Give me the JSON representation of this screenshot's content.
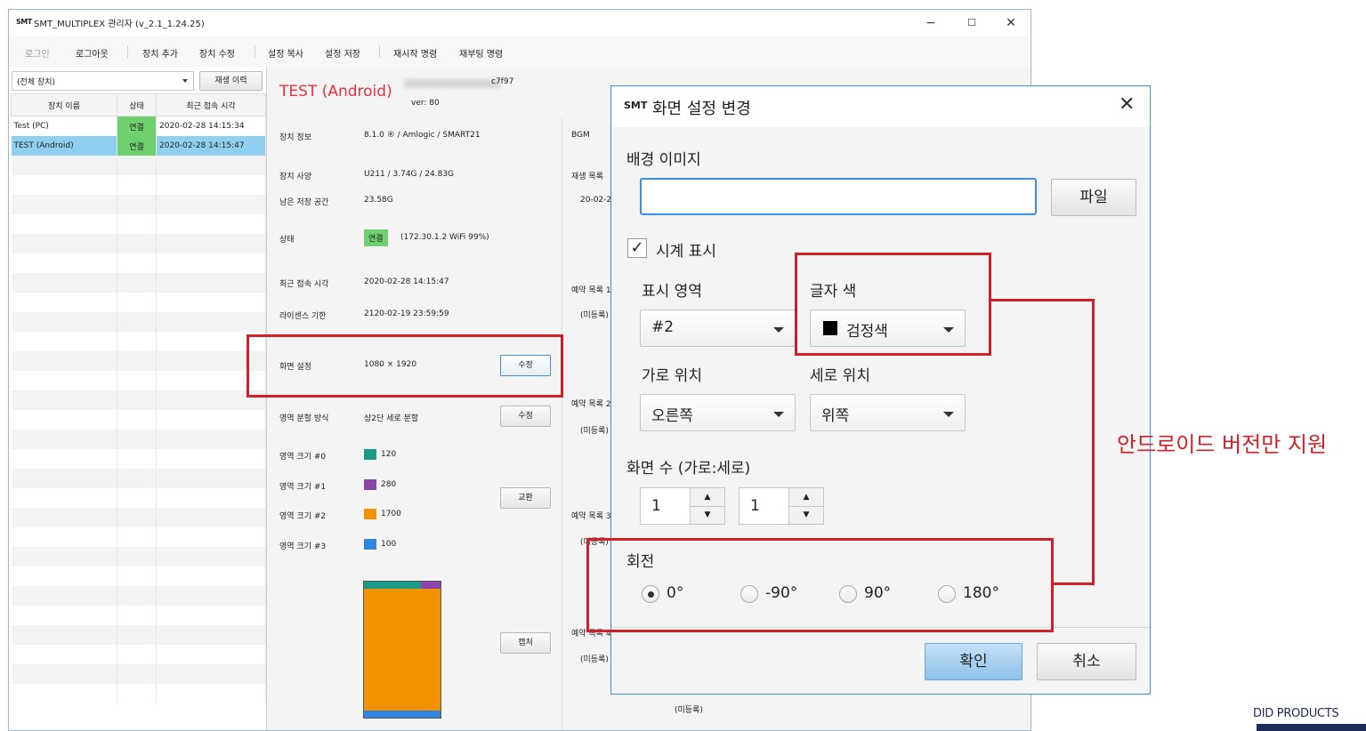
{
  "window": {
    "logo": "SMT",
    "title": "SMT_MULTIPLEX 관리자 (v_2.1_1.24.25)",
    "controls": {
      "minimize": "−",
      "maximize": "☐",
      "close": "✕"
    }
  },
  "menu": {
    "items": [
      "로그인",
      "로그아웃",
      "장치 추가",
      "장치 수정",
      "설정 복사",
      "설정 저장",
      "재시작 명령",
      "재부팅 명령"
    ]
  },
  "left_panel": {
    "device_filter": "(전체 장치)",
    "history_button": "재생 이력",
    "columns": [
      "장치 이름",
      "상태",
      "최근 접속 시각"
    ],
    "rows": [
      {
        "name": "Test (PC)",
        "status": "연결",
        "last": "2020-02-28 14:15:34"
      },
      {
        "name": "TEST (Android)",
        "status": "연결",
        "last": "2020-02-28 14:15:47"
      }
    ]
  },
  "details": {
    "device_title": "TEST (Android)",
    "version": "ver: 80",
    "id_suffix": "c7f97",
    "fields": [
      {
        "label": "장치 정보",
        "value": "8.1.0 ® / Amlogic / SMART21"
      },
      {
        "label": "장치 사양",
        "value": "U211 / 3.74G / 24.83G"
      },
      {
        "label": "남은 저장 공간",
        "value": "23.58G"
      },
      {
        "label": "상태",
        "value": "(172.30.1.2 WiFi 99%)",
        "badge": "연결"
      },
      {
        "label": "최근 접속 시각",
        "value": "2020-02-28 14:15:47"
      },
      {
        "label": "라이센스 기한",
        "value": "2120-02-19 23:59:59"
      },
      {
        "label": "화면 설정",
        "value": "1080 × 1920"
      },
      {
        "label": "영역 분할 방식",
        "value": "상2단 세로 분할"
      },
      {
        "label": "영역 크기 #0",
        "value": "120"
      },
      {
        "label": "영역 크기 #1",
        "value": "280"
      },
      {
        "label": "영역 크기 #2",
        "value": "1700"
      },
      {
        "label": "영역 크기 #3",
        "value": "100"
      }
    ],
    "buttons": {
      "edit1": "수정",
      "edit2": "수정",
      "swap": "교환",
      "capture": "캡처"
    },
    "region_colors": [
      "#1a9a86",
      "#8e44ad",
      "#f39200",
      "#2e86de"
    ],
    "right_col": {
      "bgm": "BGM",
      "playlist": "재생 목록",
      "playlist_date": "20-02-2",
      "sched1": "예약 목록 1",
      "sched2": "예약 목록 2",
      "sched3": "예약 목록 3",
      "sched4": "예약 목록 4",
      "unregistered": "(미등록)"
    }
  },
  "dialog": {
    "logo": "SMT",
    "title": "화면 설정 변경",
    "bg_image_label": "배경 이미지",
    "bg_image_value": "",
    "file_button": "파일",
    "clock_checkbox": {
      "label": "시계 표시",
      "checked": true
    },
    "display_area_label": "표시 영역",
    "display_area_value": "#2",
    "text_color_label": "글자 색",
    "text_color_value": "검정색",
    "text_color_swatch": "#000000",
    "h_pos_label": "가로 위치",
    "h_pos_value": "오른쪽",
    "v_pos_label": "세로 위치",
    "v_pos_value": "위쪽",
    "screen_count_label": "화면 수 (가로:세로)",
    "screen_h": "1",
    "screen_v": "1",
    "rotation_label": "회전",
    "rotation_options": [
      "0°",
      "-90°",
      "90°",
      "180°"
    ],
    "rotation_selected": "0°",
    "ok_button": "확인",
    "cancel_button": "취소"
  },
  "annotation": {
    "text": "안드로이드 버전만 지원",
    "color": "#d0202a"
  },
  "corner_brand": "DID PRODUCTS"
}
